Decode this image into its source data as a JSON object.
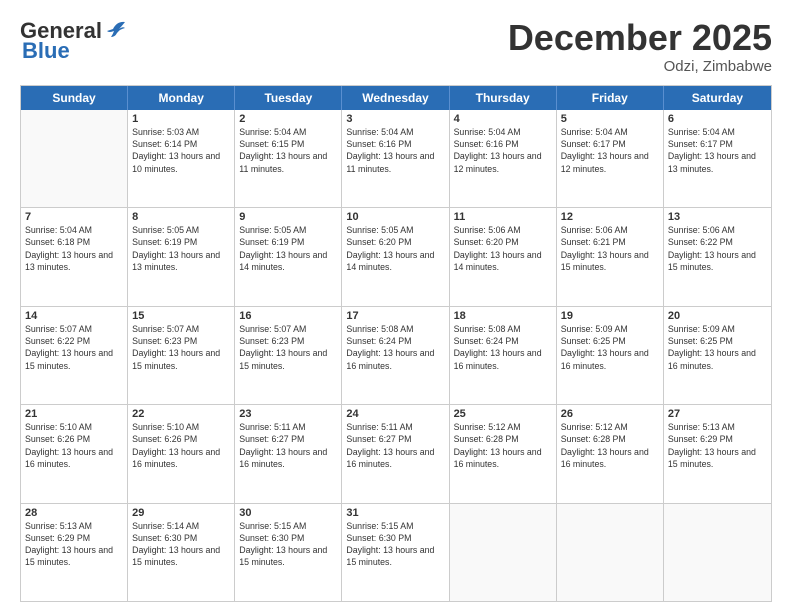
{
  "header": {
    "logo_general": "General",
    "logo_blue": "Blue",
    "month_title": "December 2025",
    "location": "Odzi, Zimbabwe"
  },
  "weekdays": [
    "Sunday",
    "Monday",
    "Tuesday",
    "Wednesday",
    "Thursday",
    "Friday",
    "Saturday"
  ],
  "rows": [
    [
      {
        "day": "",
        "sunrise": "",
        "sunset": "",
        "daylight": ""
      },
      {
        "day": "1",
        "sunrise": "Sunrise: 5:03 AM",
        "sunset": "Sunset: 6:14 PM",
        "daylight": "Daylight: 13 hours and 10 minutes."
      },
      {
        "day": "2",
        "sunrise": "Sunrise: 5:04 AM",
        "sunset": "Sunset: 6:15 PM",
        "daylight": "Daylight: 13 hours and 11 minutes."
      },
      {
        "day": "3",
        "sunrise": "Sunrise: 5:04 AM",
        "sunset": "Sunset: 6:16 PM",
        "daylight": "Daylight: 13 hours and 11 minutes."
      },
      {
        "day": "4",
        "sunrise": "Sunrise: 5:04 AM",
        "sunset": "Sunset: 6:16 PM",
        "daylight": "Daylight: 13 hours and 12 minutes."
      },
      {
        "day": "5",
        "sunrise": "Sunrise: 5:04 AM",
        "sunset": "Sunset: 6:17 PM",
        "daylight": "Daylight: 13 hours and 12 minutes."
      },
      {
        "day": "6",
        "sunrise": "Sunrise: 5:04 AM",
        "sunset": "Sunset: 6:17 PM",
        "daylight": "Daylight: 13 hours and 13 minutes."
      }
    ],
    [
      {
        "day": "7",
        "sunrise": "Sunrise: 5:04 AM",
        "sunset": "Sunset: 6:18 PM",
        "daylight": "Daylight: 13 hours and 13 minutes."
      },
      {
        "day": "8",
        "sunrise": "Sunrise: 5:05 AM",
        "sunset": "Sunset: 6:19 PM",
        "daylight": "Daylight: 13 hours and 13 minutes."
      },
      {
        "day": "9",
        "sunrise": "Sunrise: 5:05 AM",
        "sunset": "Sunset: 6:19 PM",
        "daylight": "Daylight: 13 hours and 14 minutes."
      },
      {
        "day": "10",
        "sunrise": "Sunrise: 5:05 AM",
        "sunset": "Sunset: 6:20 PM",
        "daylight": "Daylight: 13 hours and 14 minutes."
      },
      {
        "day": "11",
        "sunrise": "Sunrise: 5:06 AM",
        "sunset": "Sunset: 6:20 PM",
        "daylight": "Daylight: 13 hours and 14 minutes."
      },
      {
        "day": "12",
        "sunrise": "Sunrise: 5:06 AM",
        "sunset": "Sunset: 6:21 PM",
        "daylight": "Daylight: 13 hours and 15 minutes."
      },
      {
        "day": "13",
        "sunrise": "Sunrise: 5:06 AM",
        "sunset": "Sunset: 6:22 PM",
        "daylight": "Daylight: 13 hours and 15 minutes."
      }
    ],
    [
      {
        "day": "14",
        "sunrise": "Sunrise: 5:07 AM",
        "sunset": "Sunset: 6:22 PM",
        "daylight": "Daylight: 13 hours and 15 minutes."
      },
      {
        "day": "15",
        "sunrise": "Sunrise: 5:07 AM",
        "sunset": "Sunset: 6:23 PM",
        "daylight": "Daylight: 13 hours and 15 minutes."
      },
      {
        "day": "16",
        "sunrise": "Sunrise: 5:07 AM",
        "sunset": "Sunset: 6:23 PM",
        "daylight": "Daylight: 13 hours and 15 minutes."
      },
      {
        "day": "17",
        "sunrise": "Sunrise: 5:08 AM",
        "sunset": "Sunset: 6:24 PM",
        "daylight": "Daylight: 13 hours and 16 minutes."
      },
      {
        "day": "18",
        "sunrise": "Sunrise: 5:08 AM",
        "sunset": "Sunset: 6:24 PM",
        "daylight": "Daylight: 13 hours and 16 minutes."
      },
      {
        "day": "19",
        "sunrise": "Sunrise: 5:09 AM",
        "sunset": "Sunset: 6:25 PM",
        "daylight": "Daylight: 13 hours and 16 minutes."
      },
      {
        "day": "20",
        "sunrise": "Sunrise: 5:09 AM",
        "sunset": "Sunset: 6:25 PM",
        "daylight": "Daylight: 13 hours and 16 minutes."
      }
    ],
    [
      {
        "day": "21",
        "sunrise": "Sunrise: 5:10 AM",
        "sunset": "Sunset: 6:26 PM",
        "daylight": "Daylight: 13 hours and 16 minutes."
      },
      {
        "day": "22",
        "sunrise": "Sunrise: 5:10 AM",
        "sunset": "Sunset: 6:26 PM",
        "daylight": "Daylight: 13 hours and 16 minutes."
      },
      {
        "day": "23",
        "sunrise": "Sunrise: 5:11 AM",
        "sunset": "Sunset: 6:27 PM",
        "daylight": "Daylight: 13 hours and 16 minutes."
      },
      {
        "day": "24",
        "sunrise": "Sunrise: 5:11 AM",
        "sunset": "Sunset: 6:27 PM",
        "daylight": "Daylight: 13 hours and 16 minutes."
      },
      {
        "day": "25",
        "sunrise": "Sunrise: 5:12 AM",
        "sunset": "Sunset: 6:28 PM",
        "daylight": "Daylight: 13 hours and 16 minutes."
      },
      {
        "day": "26",
        "sunrise": "Sunrise: 5:12 AM",
        "sunset": "Sunset: 6:28 PM",
        "daylight": "Daylight: 13 hours and 16 minutes."
      },
      {
        "day": "27",
        "sunrise": "Sunrise: 5:13 AM",
        "sunset": "Sunset: 6:29 PM",
        "daylight": "Daylight: 13 hours and 15 minutes."
      }
    ],
    [
      {
        "day": "28",
        "sunrise": "Sunrise: 5:13 AM",
        "sunset": "Sunset: 6:29 PM",
        "daylight": "Daylight: 13 hours and 15 minutes."
      },
      {
        "day": "29",
        "sunrise": "Sunrise: 5:14 AM",
        "sunset": "Sunset: 6:30 PM",
        "daylight": "Daylight: 13 hours and 15 minutes."
      },
      {
        "day": "30",
        "sunrise": "Sunrise: 5:15 AM",
        "sunset": "Sunset: 6:30 PM",
        "daylight": "Daylight: 13 hours and 15 minutes."
      },
      {
        "day": "31",
        "sunrise": "Sunrise: 5:15 AM",
        "sunset": "Sunset: 6:30 PM",
        "daylight": "Daylight: 13 hours and 15 minutes."
      },
      {
        "day": "",
        "sunrise": "",
        "sunset": "",
        "daylight": ""
      },
      {
        "day": "",
        "sunrise": "",
        "sunset": "",
        "daylight": ""
      },
      {
        "day": "",
        "sunrise": "",
        "sunset": "",
        "daylight": ""
      }
    ]
  ]
}
